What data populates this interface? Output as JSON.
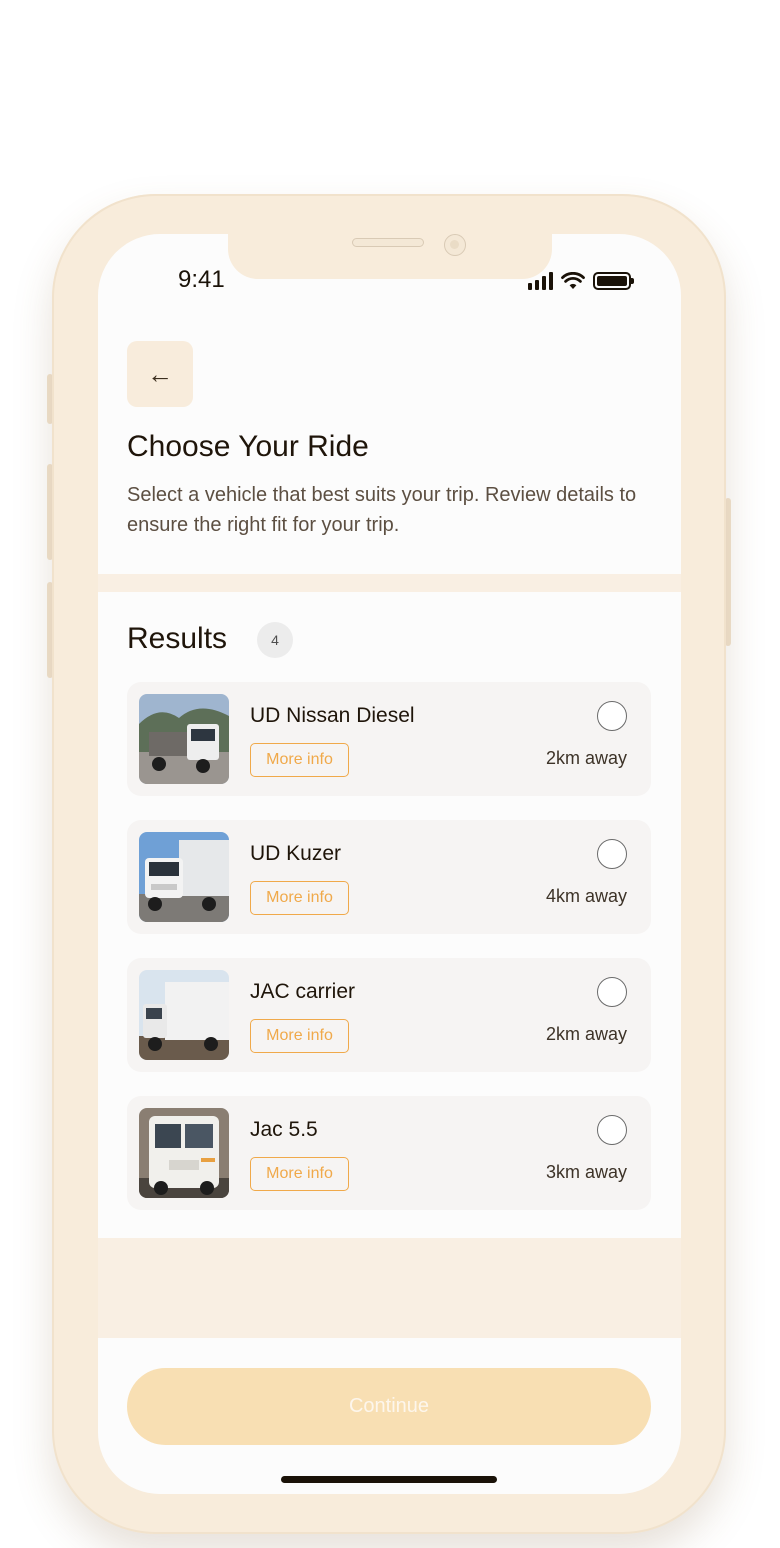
{
  "status_bar": {
    "time": "9:41"
  },
  "header": {
    "back_icon": "arrow-left-icon",
    "title": "Choose Your Ride",
    "description": "Select a vehicle that best suits your trip. Review details to ensure the right fit for your trip."
  },
  "results": {
    "title": "Results",
    "count": "4",
    "vehicles": [
      {
        "name": "UD Nissan Diesel",
        "more_info": "More info",
        "distance": "2km away",
        "selected": false
      },
      {
        "name": "UD Kuzer",
        "more_info": "More info",
        "distance": "4km away",
        "selected": false
      },
      {
        "name": "JAC carrier",
        "more_info": "More info",
        "distance": "2km away",
        "selected": false
      },
      {
        "name": "Jac 5.5",
        "more_info": "More info",
        "distance": "3km away",
        "selected": false
      }
    ]
  },
  "footer": {
    "continue_label": "Continue",
    "continue_enabled": false
  },
  "colors": {
    "accent": "#f0a94a",
    "frame": "#f8ecdb",
    "button_disabled": "#f8dfb3",
    "text_primary": "#1f150a"
  }
}
